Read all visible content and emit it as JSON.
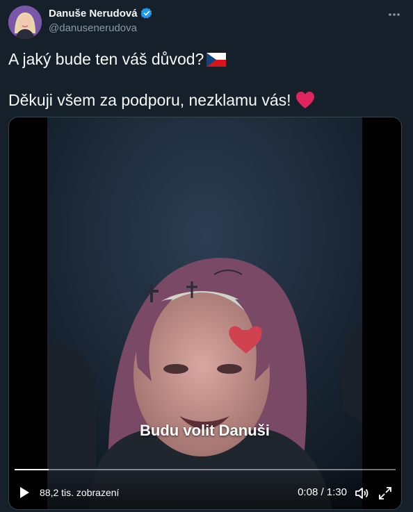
{
  "author": {
    "display_name": "Danuše Nerudová",
    "handle": "@danusenerudova"
  },
  "tweet": {
    "line1": "A jaký bude ten váš důvod?",
    "line2": "Děkuji všem za podporu, nezklamu vás!"
  },
  "video": {
    "caption": "Budu volit Danuši",
    "views": "88,2 tis. zobrazení",
    "time": "0:08 / 1:30",
    "progress": 0.089
  },
  "icons": {
    "verified": "verified-badge-icon",
    "more": "more-dots-icon",
    "flag": "czech-flag-icon",
    "heart": "red-heart-icon",
    "play": "play-icon",
    "volume": "volume-icon",
    "fullscreen": "fullscreen-icon"
  },
  "colors": {
    "background": "#15202b",
    "accent": "#1d9bf0",
    "heart": "#e0245e"
  }
}
